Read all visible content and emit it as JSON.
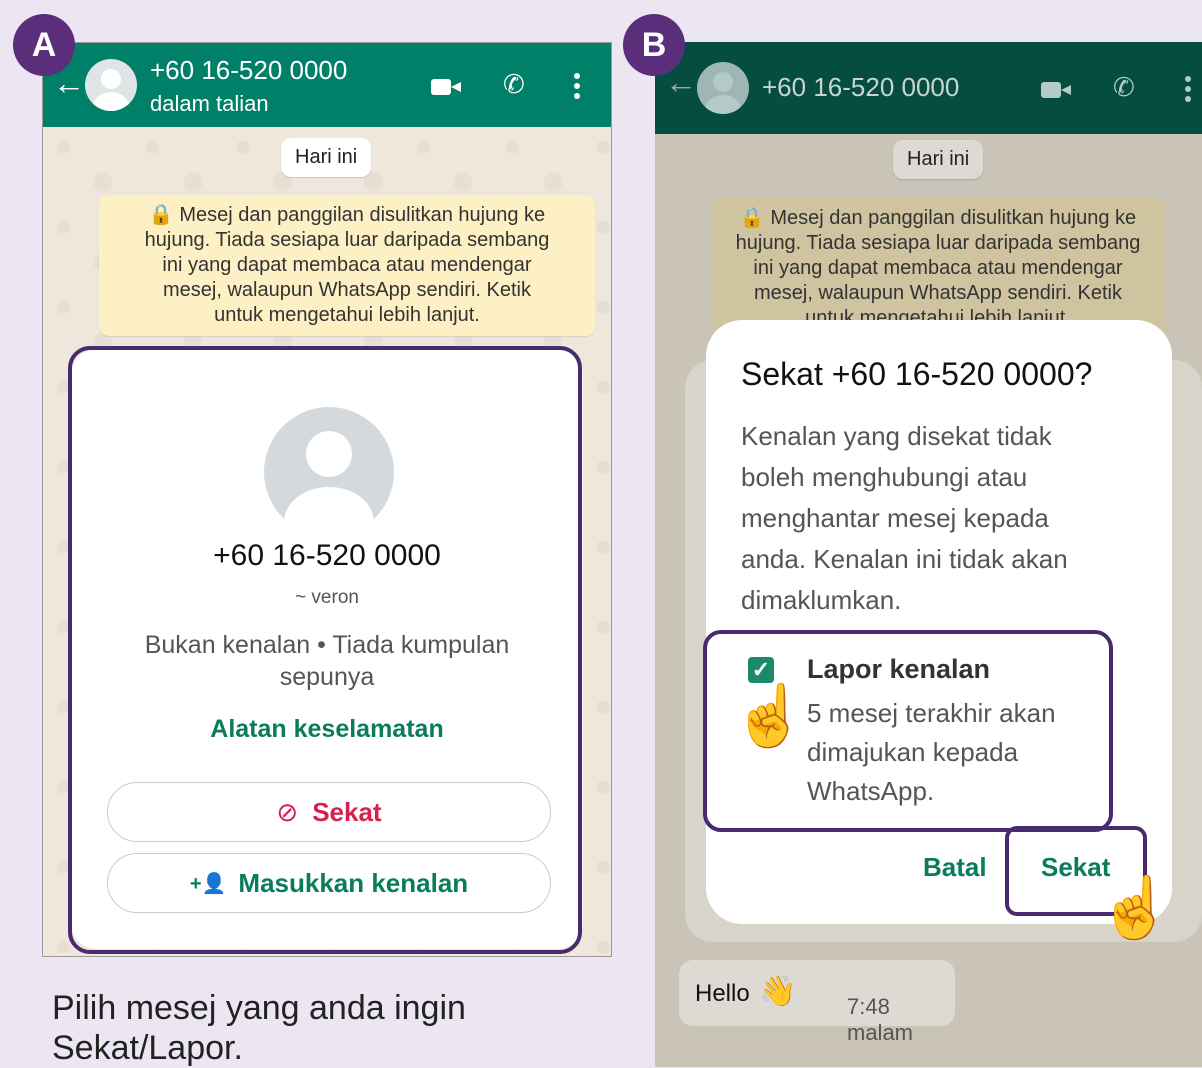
{
  "badges": {
    "a": "A",
    "b": "B"
  },
  "phone_a": {
    "contact": "+60 16-520 0000",
    "status": "dalam talian",
    "date": "Hari ini",
    "notice_lines": [
      "🔒 Mesej dan panggilan disulitkan hujung ke",
      "hujung. Tiada sesiapa luar daripada sembang",
      "ini yang dapat membaca atau mendengar",
      "mesej, walaupun WhatsApp sendiri. Ketik",
      "untuk mengetahui lebih lanjut."
    ],
    "card": {
      "name": "+60 16-520 0000",
      "alias": "~ veron",
      "info_line1": "Bukan kenalan • Tiada kumpulan",
      "info_line2": "sepunya",
      "safety": "Alatan keselamatan",
      "block_label": "Sekat",
      "block_icon": "⊘",
      "add_label": "Masukkan kenalan",
      "add_icon": "+👤"
    }
  },
  "phone_b": {
    "contact": "+60 16-520 0000",
    "date": "Hari ini",
    "notice_lines": [
      "🔒 Mesej dan panggilan disulitkan hujung ke",
      "hujung. Tiada sesiapa luar daripada sembang",
      "ini yang dapat membaca atau mendengar",
      "mesej, walaupun WhatsApp sendiri. Ketik",
      "untuk mengetahui lebih lanjut."
    ],
    "dialog": {
      "title": "Sekat +60 16-520 0000?",
      "body_lines": [
        "Kenalan yang disekat tidak",
        "boleh menghubungi atau",
        "menghantar mesej kepada",
        "anda. Kenalan ini tidak akan",
        "dimaklumkan."
      ],
      "report_title": "Lapor kenalan",
      "report_lines": [
        "5 mesej terakhir akan",
        "dimajukan kepada",
        "WhatsApp."
      ],
      "cancel": "Batal",
      "confirm": "Sekat"
    },
    "message": {
      "text": "Hello",
      "emoji": "👋",
      "time": "7:48 malam"
    }
  },
  "caption_lines": [
    "Pilih mesej yang anda ingin",
    "Sekat/Lapor."
  ],
  "colors": {
    "header": "#008069",
    "accent_green": "#0a7c5c",
    "block_red": "#d6204f",
    "outline": "#4a2a6e"
  }
}
